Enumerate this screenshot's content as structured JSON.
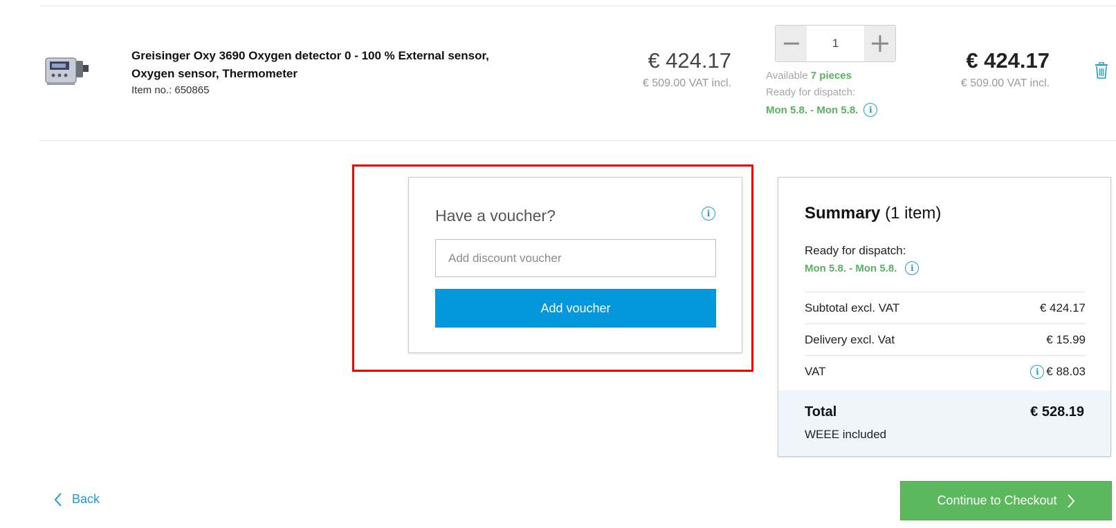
{
  "cart_item": {
    "title": "Greisinger Oxy 3690 Oxygen detector 0 - 100 % External sensor, Oxygen sensor, Thermometer",
    "item_no_label": "Item no.:",
    "item_no": "650865",
    "unit_price": "€ 424.17",
    "unit_price_vat": "€ 509.00 VAT incl.",
    "quantity": "1",
    "available_label": "Available",
    "available_value": "7 pieces",
    "ready_label": "Ready for dispatch:",
    "ready_date": "Mon 5.8. - Mon 5.8.",
    "total_price": "€ 424.17",
    "total_price_vat": "€ 509.00 VAT incl."
  },
  "voucher": {
    "title": "Have a voucher?",
    "input_placeholder": "Add discount voucher",
    "button_label": "Add voucher"
  },
  "summary": {
    "title": "Summary",
    "count": "(1 item)",
    "ready_label": "Ready for dispatch:",
    "ready_date": "Mon 5.8. - Mon 5.8.",
    "rows": [
      {
        "label": "Subtotal excl. VAT",
        "value": "€ 424.17"
      },
      {
        "label": "Delivery excl. Vat",
        "value": "€ 15.99"
      },
      {
        "label": "VAT",
        "value": "€ 88.03"
      }
    ],
    "total_label": "Total",
    "total_value": "€ 528.19",
    "weee": "WEEE included"
  },
  "nav": {
    "back_label": "Back",
    "checkout_label": "Continue to Checkout"
  },
  "colors": {
    "accent_blue": "#0397dc",
    "link_blue": "#1d9ad9",
    "green": "#58b35c",
    "checkout_green": "#5cb85c",
    "highlight_red": "#ff0000",
    "total_bg": "#eef6fc"
  },
  "icons": {
    "product_image": "product-thumbnail",
    "info": "info-icon",
    "trash": "trash-icon",
    "minus": "minus-icon",
    "plus": "plus-icon",
    "back": "chevron-left-icon",
    "checkout": "chevron-right-icon"
  }
}
